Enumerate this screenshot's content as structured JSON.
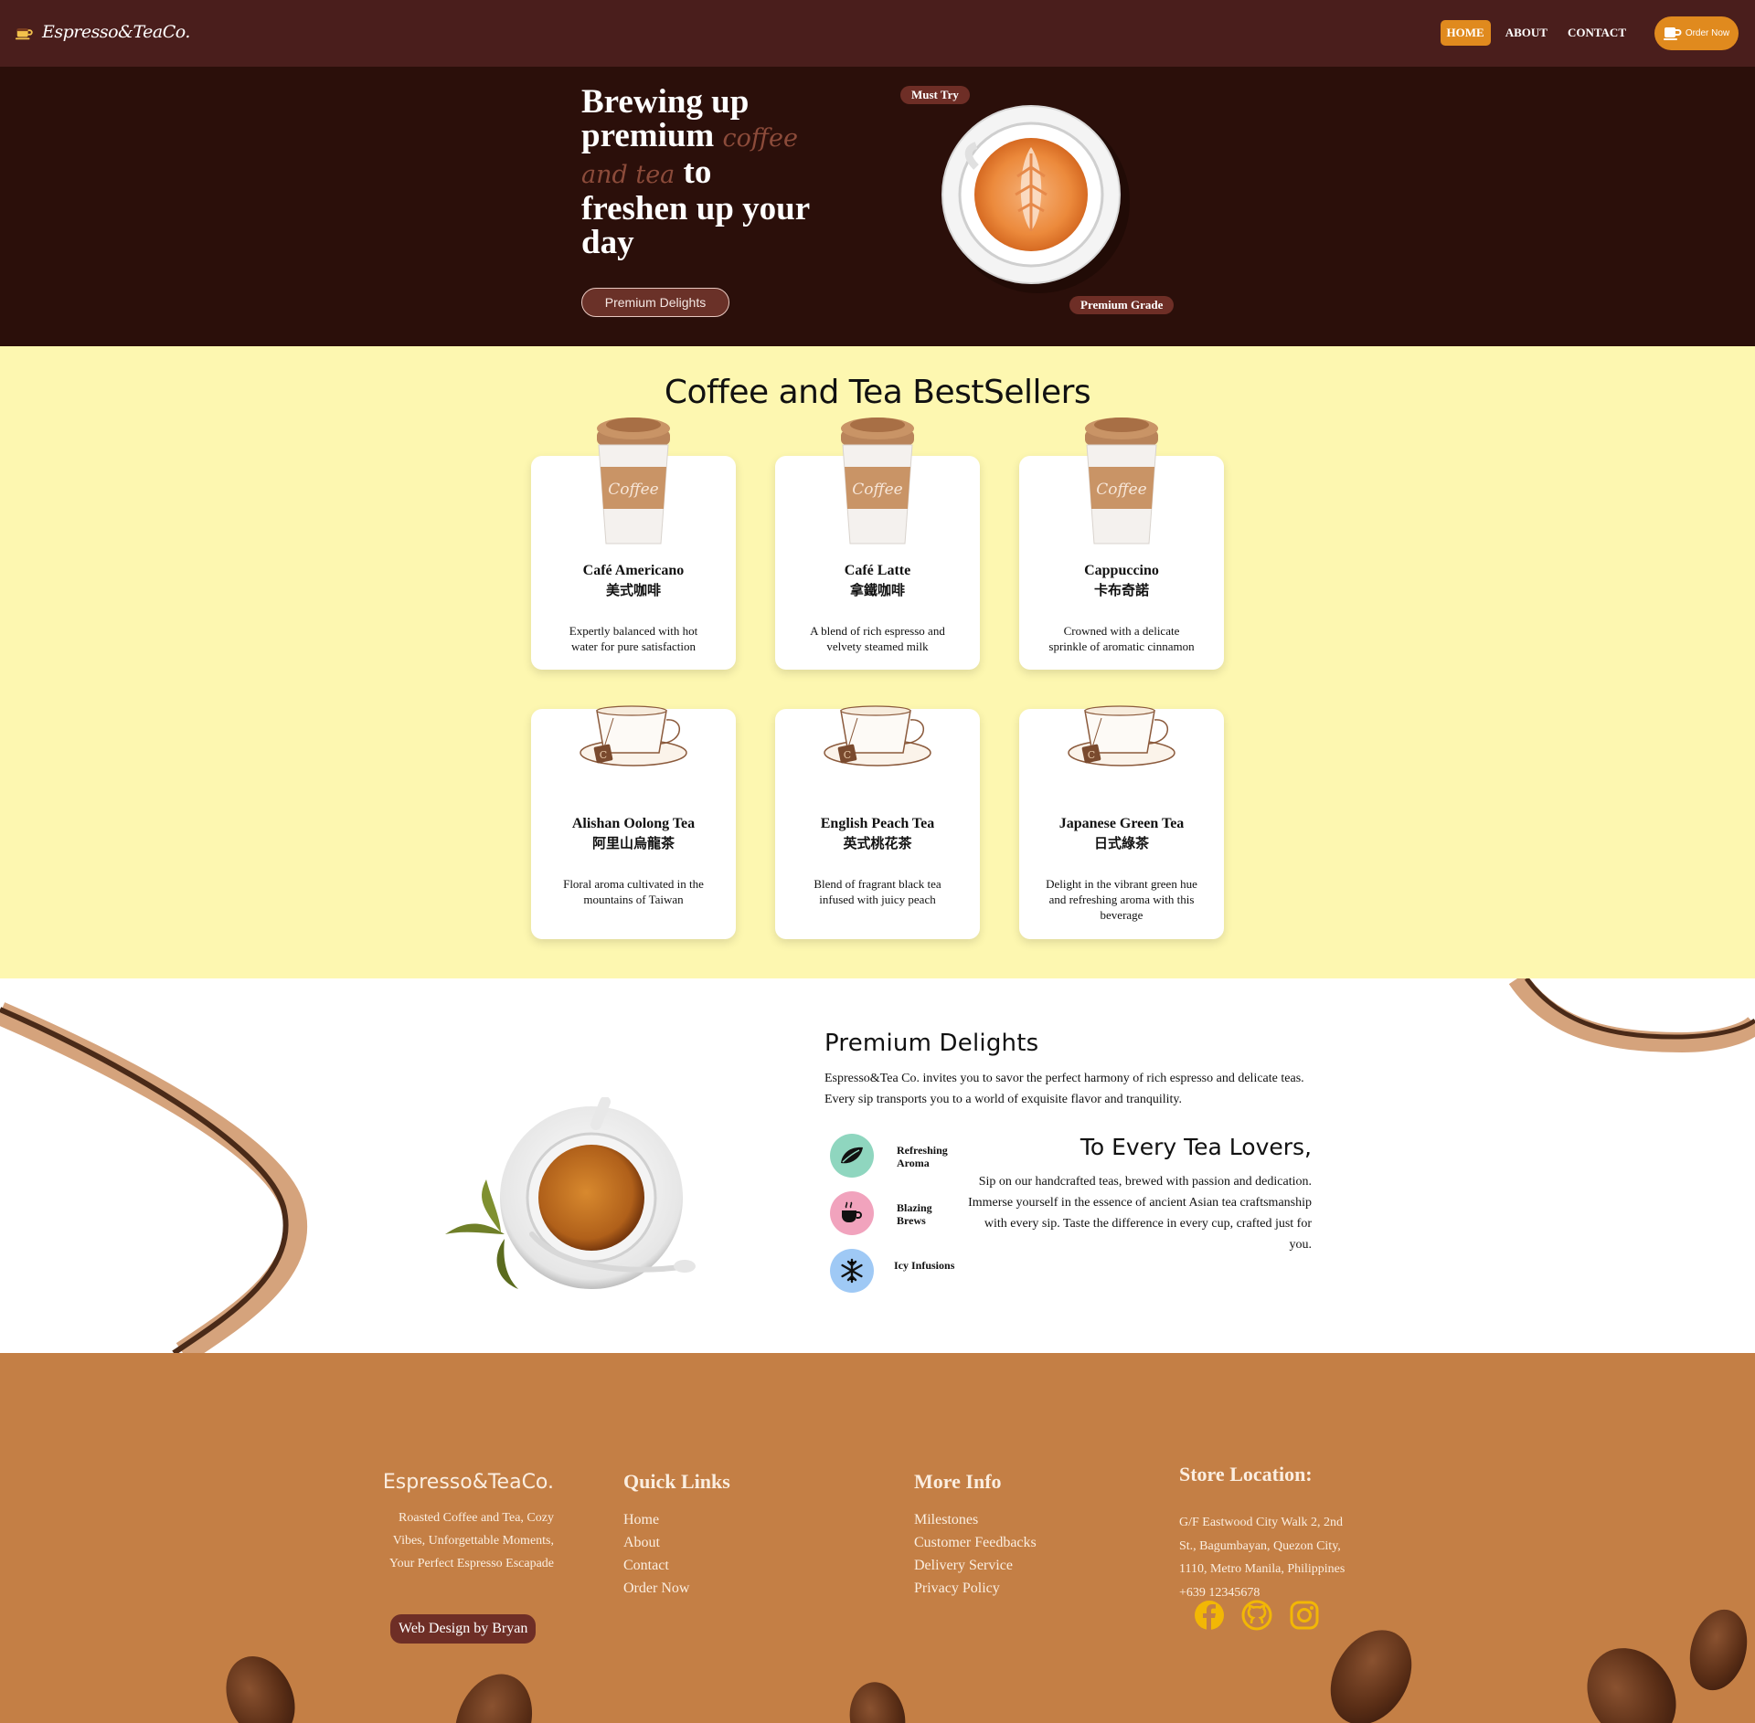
{
  "nav": {
    "brand": "Espresso&TeaCo.",
    "links": [
      "HOME",
      "ABOUT",
      "CONTACT"
    ],
    "order_label": "Order Now"
  },
  "hero": {
    "title_1": "Brewing up premium ",
    "title_accent_1": "coffee",
    "title_accent_2": "and tea",
    "title_2": " to freshen up your day",
    "button": "Premium Delights",
    "badge_must": "Must Try",
    "badge_premium": "Premium Grade"
  },
  "bestsellers": {
    "title": "Coffee and Tea BestSellers",
    "coffee": [
      {
        "name": "Café Americano",
        "zh": "美式咖啡",
        "desc": "Expertly balanced with hot water for pure satisfaction"
      },
      {
        "name": "Café Latte",
        "zh": "拿鐵咖啡",
        "desc": "A blend of rich espresso and velvety steamed milk"
      },
      {
        "name": "Cappuccino",
        "zh": "卡布奇諾",
        "desc": "Crowned with a delicate sprinkle of aromatic cinnamon"
      }
    ],
    "tea": [
      {
        "name": "Alishan Oolong Tea",
        "zh": "阿里山烏龍茶",
        "desc": "Floral aroma cultivated in the mountains of Taiwan"
      },
      {
        "name": "English Peach Tea",
        "zh": "英式桃花茶",
        "desc": "Blend of fragrant black tea infused with juicy peach"
      },
      {
        "name": "Japanese Green Tea",
        "zh": "日式綠茶",
        "desc": "Delight in the vibrant green hue and refreshing aroma with this beverage"
      }
    ],
    "cup_label": "Coffee"
  },
  "premium": {
    "title": "Premium Delights",
    "text": "Espresso&Tea Co. invites you to savor the perfect harmony of rich espresso and delicate teas. Every sip transports you to a world of exquisite flavor and tranquility.",
    "features": [
      {
        "label": "Refreshing Aroma",
        "icon": "leaf-icon",
        "color": "#8fd6bf"
      },
      {
        "label": "Blazing Brews",
        "icon": "hot-cup-icon",
        "color": "#f1a3bd"
      },
      {
        "label": "Icy Infusions",
        "icon": "snowflake-icon",
        "color": "#9fc9f5"
      }
    ],
    "tea_title": "To Every Tea Lovers,",
    "tea_text": "Sip on our handcrafted teas, brewed with passion and dedication. Immerse yourself in the essence of ancient Asian tea craftsmanship with every sip. Taste the difference in every cup, crafted just for you."
  },
  "footer": {
    "brand": "Espresso&TeaCo.",
    "tagline": "Roasted Coffee and Tea, Cozy Vibes, Unforgettable Moments, Your Perfect Espresso Escapade",
    "credit": "Web Design by Bryan",
    "quick_title": "Quick Links",
    "quick_links": [
      "Home",
      "About",
      "Contact",
      "Order Now"
    ],
    "info_title": "More Info",
    "info_links": [
      "Milestones",
      "Customer Feedbacks",
      "Delivery Service",
      "Privacy Policy"
    ],
    "loc_title": "Store Location:",
    "address": "G/F Eastwood City Walk 2, 2nd St., Bagumbayan, Quezon City, 1110, Metro Manila, Philippines",
    "phone": "+639 12345678",
    "socials": [
      "facebook-icon",
      "github-icon",
      "instagram-icon"
    ]
  },
  "colors": {
    "nav_bg": "#4a1e1c",
    "hero_bg": "#2b0f0a",
    "accent_orange": "#e08a1e",
    "best_bg": "#fdf7b0",
    "footer_bg": "#c47f45",
    "badge_bg": "#6e2e26",
    "social_yellow": "#f2b705"
  }
}
